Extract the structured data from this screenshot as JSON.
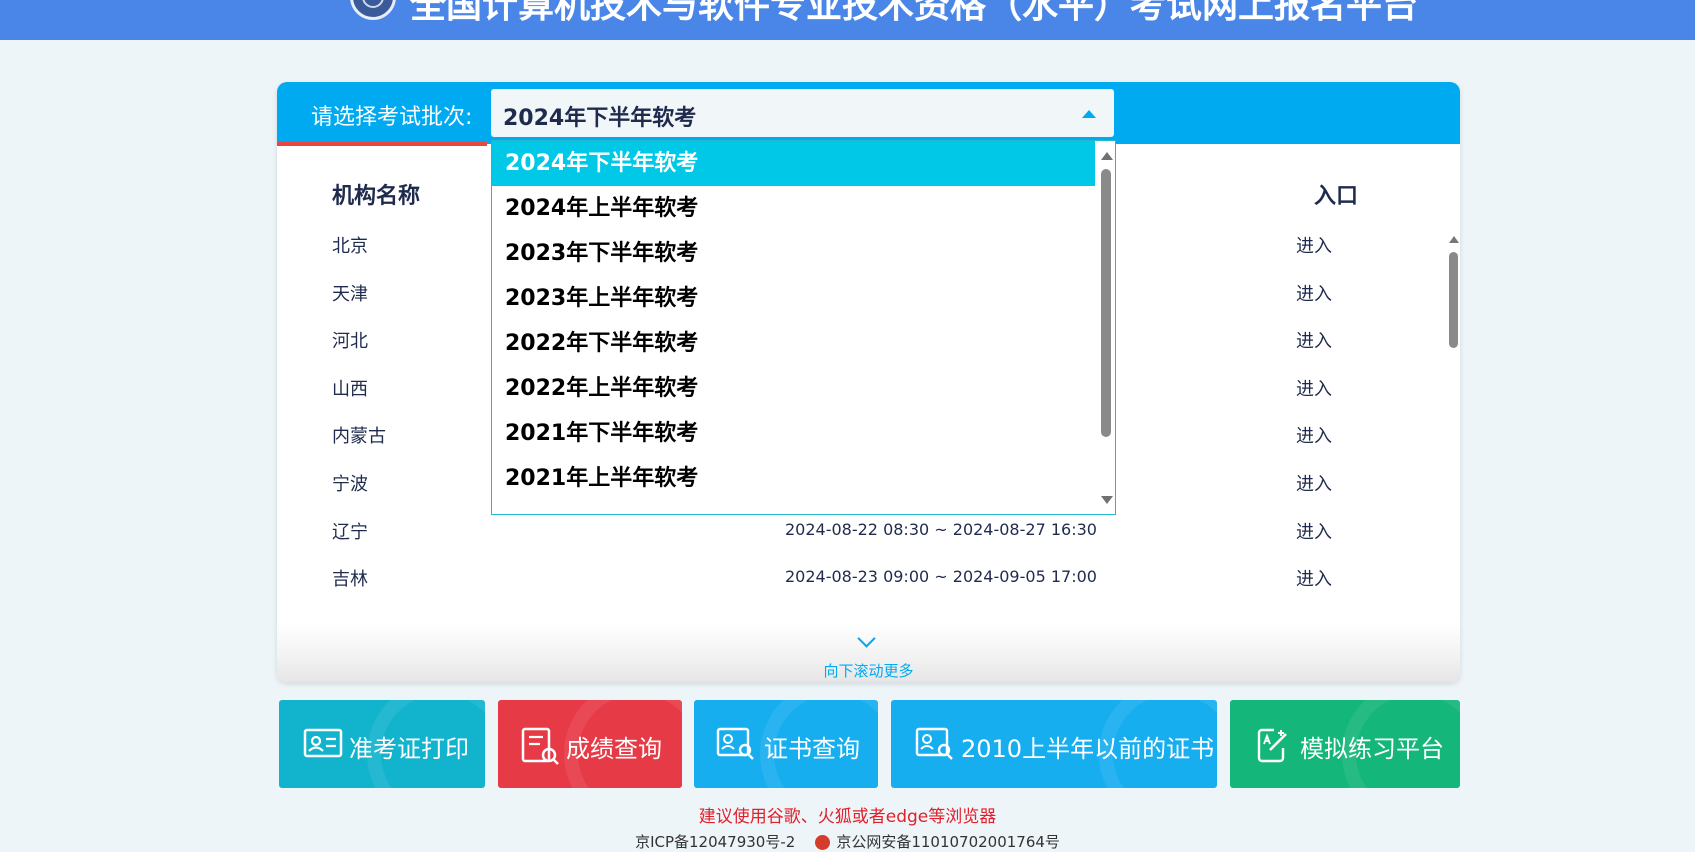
{
  "header": {
    "title": "全国计算机技术与软件专业技术资格（水平）考试网上报名平台"
  },
  "selector": {
    "label": "请选择考试批次:",
    "selected": "2024年下半年软考",
    "options": [
      "2024年下半年软考",
      "2024年上半年软考",
      "2023年下半年软考",
      "2023年上半年软考",
      "2022年下半年软考",
      "2022年上半年软考",
      "2021年下半年软考",
      "2021年上半年软考"
    ]
  },
  "table": {
    "columns": {
      "org": "机构名称",
      "entry": "入口"
    },
    "rows": [
      {
        "org": "北京",
        "time": "",
        "entry": "进入"
      },
      {
        "org": "天津",
        "time": "",
        "entry": "进入"
      },
      {
        "org": "河北",
        "time": "",
        "entry": "进入"
      },
      {
        "org": "山西",
        "time": "",
        "entry": "进入"
      },
      {
        "org": "内蒙古",
        "time": "",
        "entry": "进入"
      },
      {
        "org": "宁波",
        "time": "",
        "entry": "进入"
      },
      {
        "org": "辽宁",
        "time": "2024-08-22 08:30 ~ 2024-08-27 16:30",
        "entry": "进入"
      },
      {
        "org": "吉林",
        "time": "2024-08-23 09:00 ~ 2024-09-05 17:00",
        "entry": "进入"
      }
    ],
    "scroll_more": "向下滚动更多"
  },
  "buttons": [
    {
      "label": "准考证打印",
      "color": "#12b3cc",
      "icon": "id-card-icon"
    },
    {
      "label": "成绩查询",
      "color": "#e63a46",
      "icon": "score-search-icon"
    },
    {
      "label": "证书查询",
      "color": "#17aef0",
      "icon": "certificate-search-icon"
    },
    {
      "label": "2010上半年以前的证书",
      "color": "#17aef0",
      "icon": "certificate-search-icon"
    },
    {
      "label": "模拟练习平台",
      "color": "#14b679",
      "icon": "practice-edit-icon"
    }
  ],
  "footer": {
    "browser_note": "建议使用谷歌、火狐或者edge等浏览器",
    "icp": "京ICP备12047930号-2",
    "police": "京公网安备11010702001764号"
  }
}
